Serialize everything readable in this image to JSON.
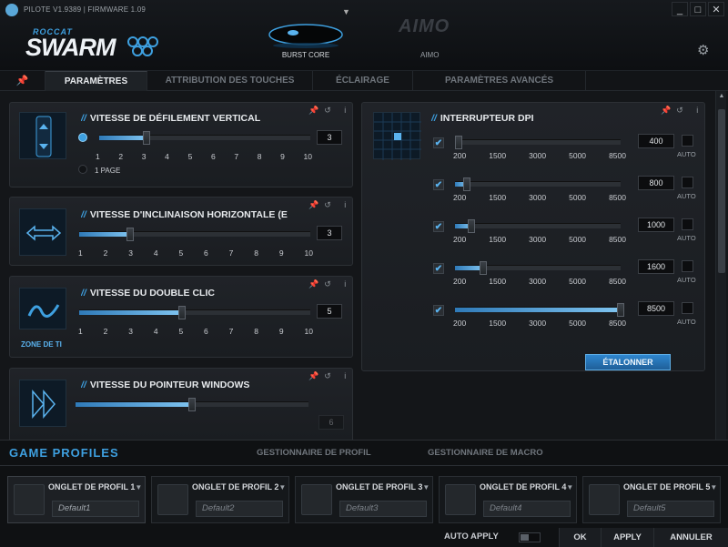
{
  "titlebar": {
    "version": "PILOTE V1.9389 | FIRMWARE 1.09",
    "brand": "ROCCAT",
    "product": "SWARM",
    "device_name": "BURST CORE",
    "aimo_logo": "AIMO",
    "aimo_name": "AIMO",
    "window_buttons": [
      "_",
      "□",
      "✕"
    ]
  },
  "tabs": {
    "items": [
      {
        "label": "PARAMÈTRES"
      },
      {
        "label": "ATTRIBUTION DES TOUCHES"
      },
      {
        "label": "ÉCLAIRAGE"
      },
      {
        "label": "PARAMÈTRES AVANCÉS"
      }
    ]
  },
  "panels": {
    "vertical_scroll": {
      "title": "VITESSE DE DÉFILEMENT VERTICAL",
      "value": "3",
      "level": 3,
      "ticks": [
        "1",
        "2",
        "3",
        "4",
        "5",
        "6",
        "7",
        "8",
        "9",
        "10"
      ],
      "page_option": "1 PAGE"
    },
    "horizontal_tilt": {
      "title": "VITESSE D'INCLINAISON HORIZONTALE (E",
      "value": "3",
      "level": 3,
      "ticks": [
        "1",
        "2",
        "3",
        "4",
        "5",
        "6",
        "7",
        "8",
        "9",
        "10"
      ]
    },
    "double_click": {
      "title": "VITESSE DU DOUBLE CLIC",
      "value": "5",
      "level": 5,
      "ticks": [
        "1",
        "2",
        "3",
        "4",
        "5",
        "6",
        "7",
        "8",
        "9",
        "10"
      ],
      "zone_label": "ZONE DE TI"
    },
    "pointer": {
      "title": "VITESSE DU POINTEUR WINDOWS",
      "value": "6",
      "level": 6
    },
    "dpi": {
      "title": "INTERRUPTEUR DPI",
      "ticks": [
        "200",
        "1500",
        "3000",
        "5000",
        "8500"
      ],
      "auto_label": "AUTO",
      "rows": [
        {
          "value": "400",
          "dpi": 400
        },
        {
          "value": "800",
          "dpi": 800
        },
        {
          "value": "1000",
          "dpi": 1000
        },
        {
          "value": "1600",
          "dpi": 1600
        },
        {
          "value": "8500",
          "dpi": 8500
        }
      ],
      "calibrate": "ÉTALONNER"
    }
  },
  "profiles": {
    "title": "GAME PROFILES",
    "manager_tab": "GESTIONNAIRE DE PROFIL",
    "macro_tab": "GESTIONNAIRE DE MACRO",
    "cards": [
      {
        "name": "ONGLET DE PROFIL 1",
        "preset": "Default1"
      },
      {
        "name": "ONGLET DE PROFIL 2",
        "preset": "Default2"
      },
      {
        "name": "ONGLET DE PROFIL 3",
        "preset": "Default3"
      },
      {
        "name": "ONGLET DE PROFIL 4",
        "preset": "Default4"
      },
      {
        "name": "ONGLET DE PROFIL 5",
        "preset": "Default5"
      }
    ],
    "auto_apply": "AUTO APPLY",
    "ok": "OK",
    "apply": "APPLY",
    "cancel": "ANNULER"
  }
}
